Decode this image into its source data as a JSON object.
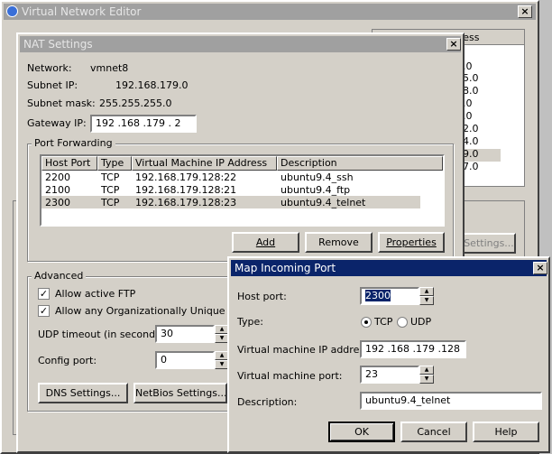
{
  "vne": {
    "title": "Virtual Network Editor",
    "close": "×",
    "bg_col_header": "ress",
    "bg_values": [
      ".0",
      "5.0",
      "8.0",
      ".0",
      ".0",
      "2.0",
      "4.0",
      "9.0",
      "7.0"
    ],
    "bg_button": "Settings..."
  },
  "nat": {
    "title": "NAT Settings",
    "close": "×",
    "network_label": "Network:",
    "network_value": "vmnet8",
    "subnet_ip_label": "Subnet IP:",
    "subnet_ip_value": "192.168.179.0",
    "subnet_mask_label": "Subnet mask:",
    "subnet_mask_value": "255.255.255.0",
    "gateway_label": "Gateway IP:",
    "gateway_value": "192 .168 .179 .  2",
    "port_forwarding_label": "Port Forwarding",
    "columns": [
      "Host Port",
      "Type",
      "Virtual Machine IP Address",
      "Description"
    ],
    "rows": [
      {
        "host_port": "2200",
        "type": "TCP",
        "ip": "192.168.179.128:22",
        "desc": "ubuntu9.4_ssh"
      },
      {
        "host_port": "2100",
        "type": "TCP",
        "ip": "192.168.179.128:21",
        "desc": "ubuntu9.4_ftp"
      },
      {
        "host_port": "2300",
        "type": "TCP",
        "ip": "192.168.179.128:23",
        "desc": "ubuntu9.4_telnet"
      }
    ],
    "add_button": "Add",
    "remove_button": "Remove",
    "properties_button": "Properties",
    "advanced_label": "Advanced",
    "allow_ftp_label": "Allow active FTP",
    "allow_oui_label": "Allow any Organizationally Unique Ident",
    "udp_timeout_label": "UDP timeout (in seconds):",
    "udp_timeout_value": "30",
    "config_port_label": "Config port:",
    "config_port_value": "0",
    "dns_button": "DNS Settings...",
    "netbios_button": "NetBios Settings..."
  },
  "map": {
    "title": "Map Incoming Port",
    "close": "×",
    "host_port_label": "Host port:",
    "host_port_value": "2300",
    "type_label": "Type:",
    "tcp_label": "TCP",
    "udp_label": "UDP",
    "vm_ip_label": "Virtual machine IP address:",
    "vm_ip_value": "192 .168 .179 .128",
    "vm_port_label": "Virtual machine port:",
    "vm_port_value": "23",
    "description_label": "Description:",
    "description_value": "ubuntu9.4_telnet",
    "ok_button": "OK",
    "cancel_button": "Cancel",
    "help_button": "Help"
  }
}
